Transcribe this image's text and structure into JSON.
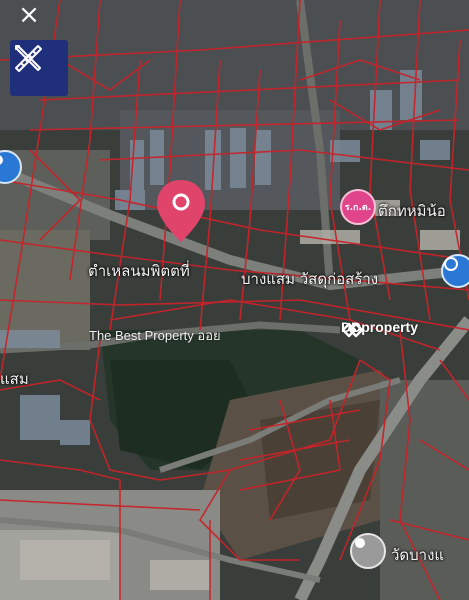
{
  "controls": {
    "close_label": "×",
    "close_icon": "close-icon",
    "measure_icon": "ruler-pencil-icon"
  },
  "labels": {
    "place_top_right": "ตึกทหมิน้อ",
    "road_center_left": "ตำเหลนมพิตตที่",
    "road_center_right": "บางแสม วัสดุก่อสร้าง",
    "area_left": "แสม",
    "place_bottom_right": "วัดบางแ"
  },
  "watermark": {
    "text": "The Best Property  ออย",
    "brand": "DDproperty"
  },
  "markers": {
    "property_pin": "map-pin-icon",
    "poi_badge_text": "ร.ก.ต.",
    "colors": {
      "pin": "#e0446a",
      "poi_pink": "#e0448a",
      "poi_blue": "#2a78d6",
      "poi_gray": "#9a9a9a",
      "parcel_line": "#c8232a",
      "tool_button": "#1f2f7a"
    }
  }
}
